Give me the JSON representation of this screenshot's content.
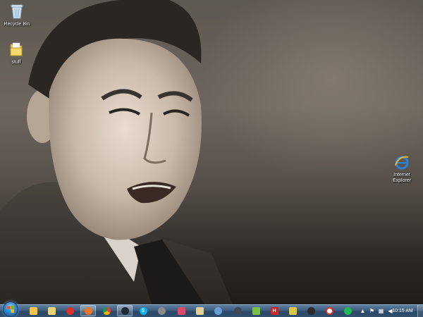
{
  "desktop": {
    "icons": [
      {
        "label": "Recycle Bin",
        "icon": "recycle-bin-icon"
      },
      {
        "label": "stuff",
        "icon": "folder-icon"
      },
      {
        "label": "Internet Explorer",
        "icon": "internet-explorer-icon"
      }
    ],
    "wallpaper": "black-and-white photo of a grimacing man in a suit"
  },
  "taskbar": {
    "start": "windows-start-orb",
    "pinned": [
      {
        "name": "windows-explorer",
        "color": "#f3c54a"
      },
      {
        "name": "file-manager",
        "color": "#e8d27a"
      },
      {
        "name": "opera",
        "color": "#d9302c"
      },
      {
        "name": "firefox",
        "color": "#e8772e"
      },
      {
        "name": "chrome",
        "color": "#4caf50"
      },
      {
        "name": "steam",
        "color": "#1b2838"
      },
      {
        "name": "skype",
        "color": "#00aff0"
      },
      {
        "name": "chat",
        "color": "#8a8a8a"
      },
      {
        "name": "media",
        "color": "#d64b6a"
      },
      {
        "name": "picture-viewer",
        "color": "#e0d0a0"
      },
      {
        "name": "messenger",
        "color": "#6a9fd4"
      },
      {
        "name": "steam-2",
        "color": "#3c4a5c"
      },
      {
        "name": "paint",
        "color": "#7bbf4a"
      },
      {
        "name": "h-app",
        "color": "#c8262c"
      },
      {
        "name": "notes",
        "color": "#d8c84a"
      },
      {
        "name": "dark-app",
        "color": "#2a2a2a"
      },
      {
        "name": "arrow-app",
        "color": "#4a86c8"
      },
      {
        "name": "opera-2",
        "color": "#d9302c"
      },
      {
        "name": "spotify",
        "color": "#1db954"
      }
    ],
    "clock": "10:15 AM",
    "tray": [
      "up-arrow-icon",
      "flag-icon",
      "network-icon",
      "volume-icon"
    ]
  }
}
